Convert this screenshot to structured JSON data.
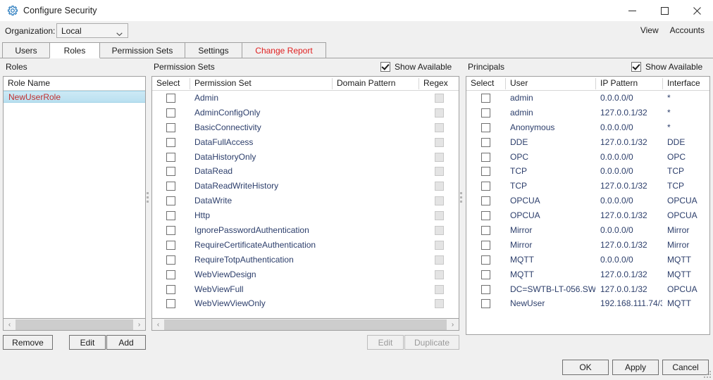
{
  "window": {
    "title": "Configure Security",
    "icon": "gear-icon",
    "minimize_label": "–",
    "maximize_label": "□",
    "close_label": "✕"
  },
  "header": {
    "organization_label": "Organization:",
    "organization_value": "Local",
    "organization_caret": "⌄",
    "links": [
      {
        "label": "View"
      },
      {
        "label": "Accounts"
      }
    ]
  },
  "tabs": [
    {
      "label": "Users",
      "active": false,
      "alert": false
    },
    {
      "label": "Roles",
      "active": true,
      "alert": false
    },
    {
      "label": "Permission Sets",
      "active": false,
      "alert": false
    },
    {
      "label": "Settings",
      "active": false,
      "alert": false
    },
    {
      "label": "Change Report",
      "active": false,
      "alert": true
    }
  ],
  "roles_panel": {
    "title": "Roles",
    "column_header": "Role Name",
    "rows": [
      {
        "name": "NewUserRole",
        "selected": true
      }
    ],
    "buttons": [
      {
        "label": "Remove",
        "disabled": false
      },
      {
        "label": "Edit",
        "disabled": false
      },
      {
        "label": "Add",
        "disabled": false
      }
    ]
  },
  "permission_sets_panel": {
    "title": "Permission Sets",
    "show_available_label": "Show Available",
    "show_available_checked": true,
    "columns": [
      "Select",
      "Permission Set",
      "Domain Pattern",
      "Regex"
    ],
    "rows": [
      {
        "select": false,
        "name": "Admin",
        "domain_pattern": "",
        "regex": false
      },
      {
        "select": false,
        "name": "AdminConfigOnly",
        "domain_pattern": "",
        "regex": false
      },
      {
        "select": false,
        "name": "BasicConnectivity",
        "domain_pattern": "",
        "regex": false
      },
      {
        "select": false,
        "name": "DataFullAccess",
        "domain_pattern": "",
        "regex": false
      },
      {
        "select": false,
        "name": "DataHistoryOnly",
        "domain_pattern": "",
        "regex": false
      },
      {
        "select": false,
        "name": "DataRead",
        "domain_pattern": "",
        "regex": false
      },
      {
        "select": false,
        "name": "DataReadWriteHistory",
        "domain_pattern": "",
        "regex": false
      },
      {
        "select": false,
        "name": "DataWrite",
        "domain_pattern": "",
        "regex": false
      },
      {
        "select": false,
        "name": "Http",
        "domain_pattern": "",
        "regex": false
      },
      {
        "select": false,
        "name": "IgnorePasswordAuthentication",
        "domain_pattern": "",
        "regex": false
      },
      {
        "select": false,
        "name": "RequireCertificateAuthentication",
        "domain_pattern": "",
        "regex": false
      },
      {
        "select": false,
        "name": "RequireTotpAuthentication",
        "domain_pattern": "",
        "regex": false
      },
      {
        "select": false,
        "name": "WebViewDesign",
        "domain_pattern": "",
        "regex": false
      },
      {
        "select": false,
        "name": "WebViewFull",
        "domain_pattern": "",
        "regex": false
      },
      {
        "select": false,
        "name": "WebViewViewOnly",
        "domain_pattern": "",
        "regex": false
      }
    ],
    "buttons": [
      {
        "label": "Edit",
        "disabled": true
      },
      {
        "label": "Duplicate",
        "disabled": true
      }
    ]
  },
  "principals_panel": {
    "title": "Principals",
    "show_available_label": "Show Available",
    "show_available_checked": true,
    "columns": [
      "Select",
      "User",
      "IP Pattern",
      "Interface"
    ],
    "rows": [
      {
        "select": false,
        "user": "admin",
        "ip_pattern": "0.0.0.0/0",
        "interface": "*"
      },
      {
        "select": false,
        "user": "admin",
        "ip_pattern": "127.0.0.1/32",
        "interface": "*"
      },
      {
        "select": false,
        "user": "Anonymous",
        "ip_pattern": "0.0.0.0/0",
        "interface": "*"
      },
      {
        "select": false,
        "user": "DDE",
        "ip_pattern": "127.0.0.1/32",
        "interface": "DDE"
      },
      {
        "select": false,
        "user": "OPC",
        "ip_pattern": "0.0.0.0/0",
        "interface": "OPC"
      },
      {
        "select": false,
        "user": "TCP",
        "ip_pattern": "0.0.0.0/0",
        "interface": "TCP"
      },
      {
        "select": false,
        "user": "TCP",
        "ip_pattern": "127.0.0.1/32",
        "interface": "TCP"
      },
      {
        "select": false,
        "user": "OPCUA",
        "ip_pattern": "0.0.0.0/0",
        "interface": "OPCUA"
      },
      {
        "select": false,
        "user": "OPCUA",
        "ip_pattern": "127.0.0.1/32",
        "interface": "OPCUA"
      },
      {
        "select": false,
        "user": "Mirror",
        "ip_pattern": "0.0.0.0/0",
        "interface": "Mirror"
      },
      {
        "select": false,
        "user": "Mirror",
        "ip_pattern": "127.0.0.1/32",
        "interface": "Mirror"
      },
      {
        "select": false,
        "user": "MQTT",
        "ip_pattern": "0.0.0.0/0",
        "interface": "MQTT"
      },
      {
        "select": false,
        "user": "MQTT",
        "ip_pattern": "127.0.0.1/32",
        "interface": "MQTT"
      },
      {
        "select": false,
        "user": "DC=SWTB-LT-056.SW",
        "ip_pattern": "127.0.0.1/32",
        "interface": "OPCUA"
      },
      {
        "select": false,
        "user": "NewUser",
        "ip_pattern": "192.168.111.74/3",
        "interface": "MQTT"
      }
    ]
  },
  "scrollbars": {
    "left_arrow": "‹",
    "right_arrow": "›"
  },
  "footer": {
    "buttons": [
      {
        "label": "OK",
        "disabled": false
      },
      {
        "label": "Apply",
        "disabled": false
      },
      {
        "label": "Cancel",
        "disabled": false
      }
    ]
  },
  "colors": {
    "accent_blue": "#2b7cbf",
    "alert_red": "#e02020",
    "selected_role_text": "#c03030",
    "grid_text": "#2c3e6b",
    "chrome": "#f0f0f0"
  }
}
